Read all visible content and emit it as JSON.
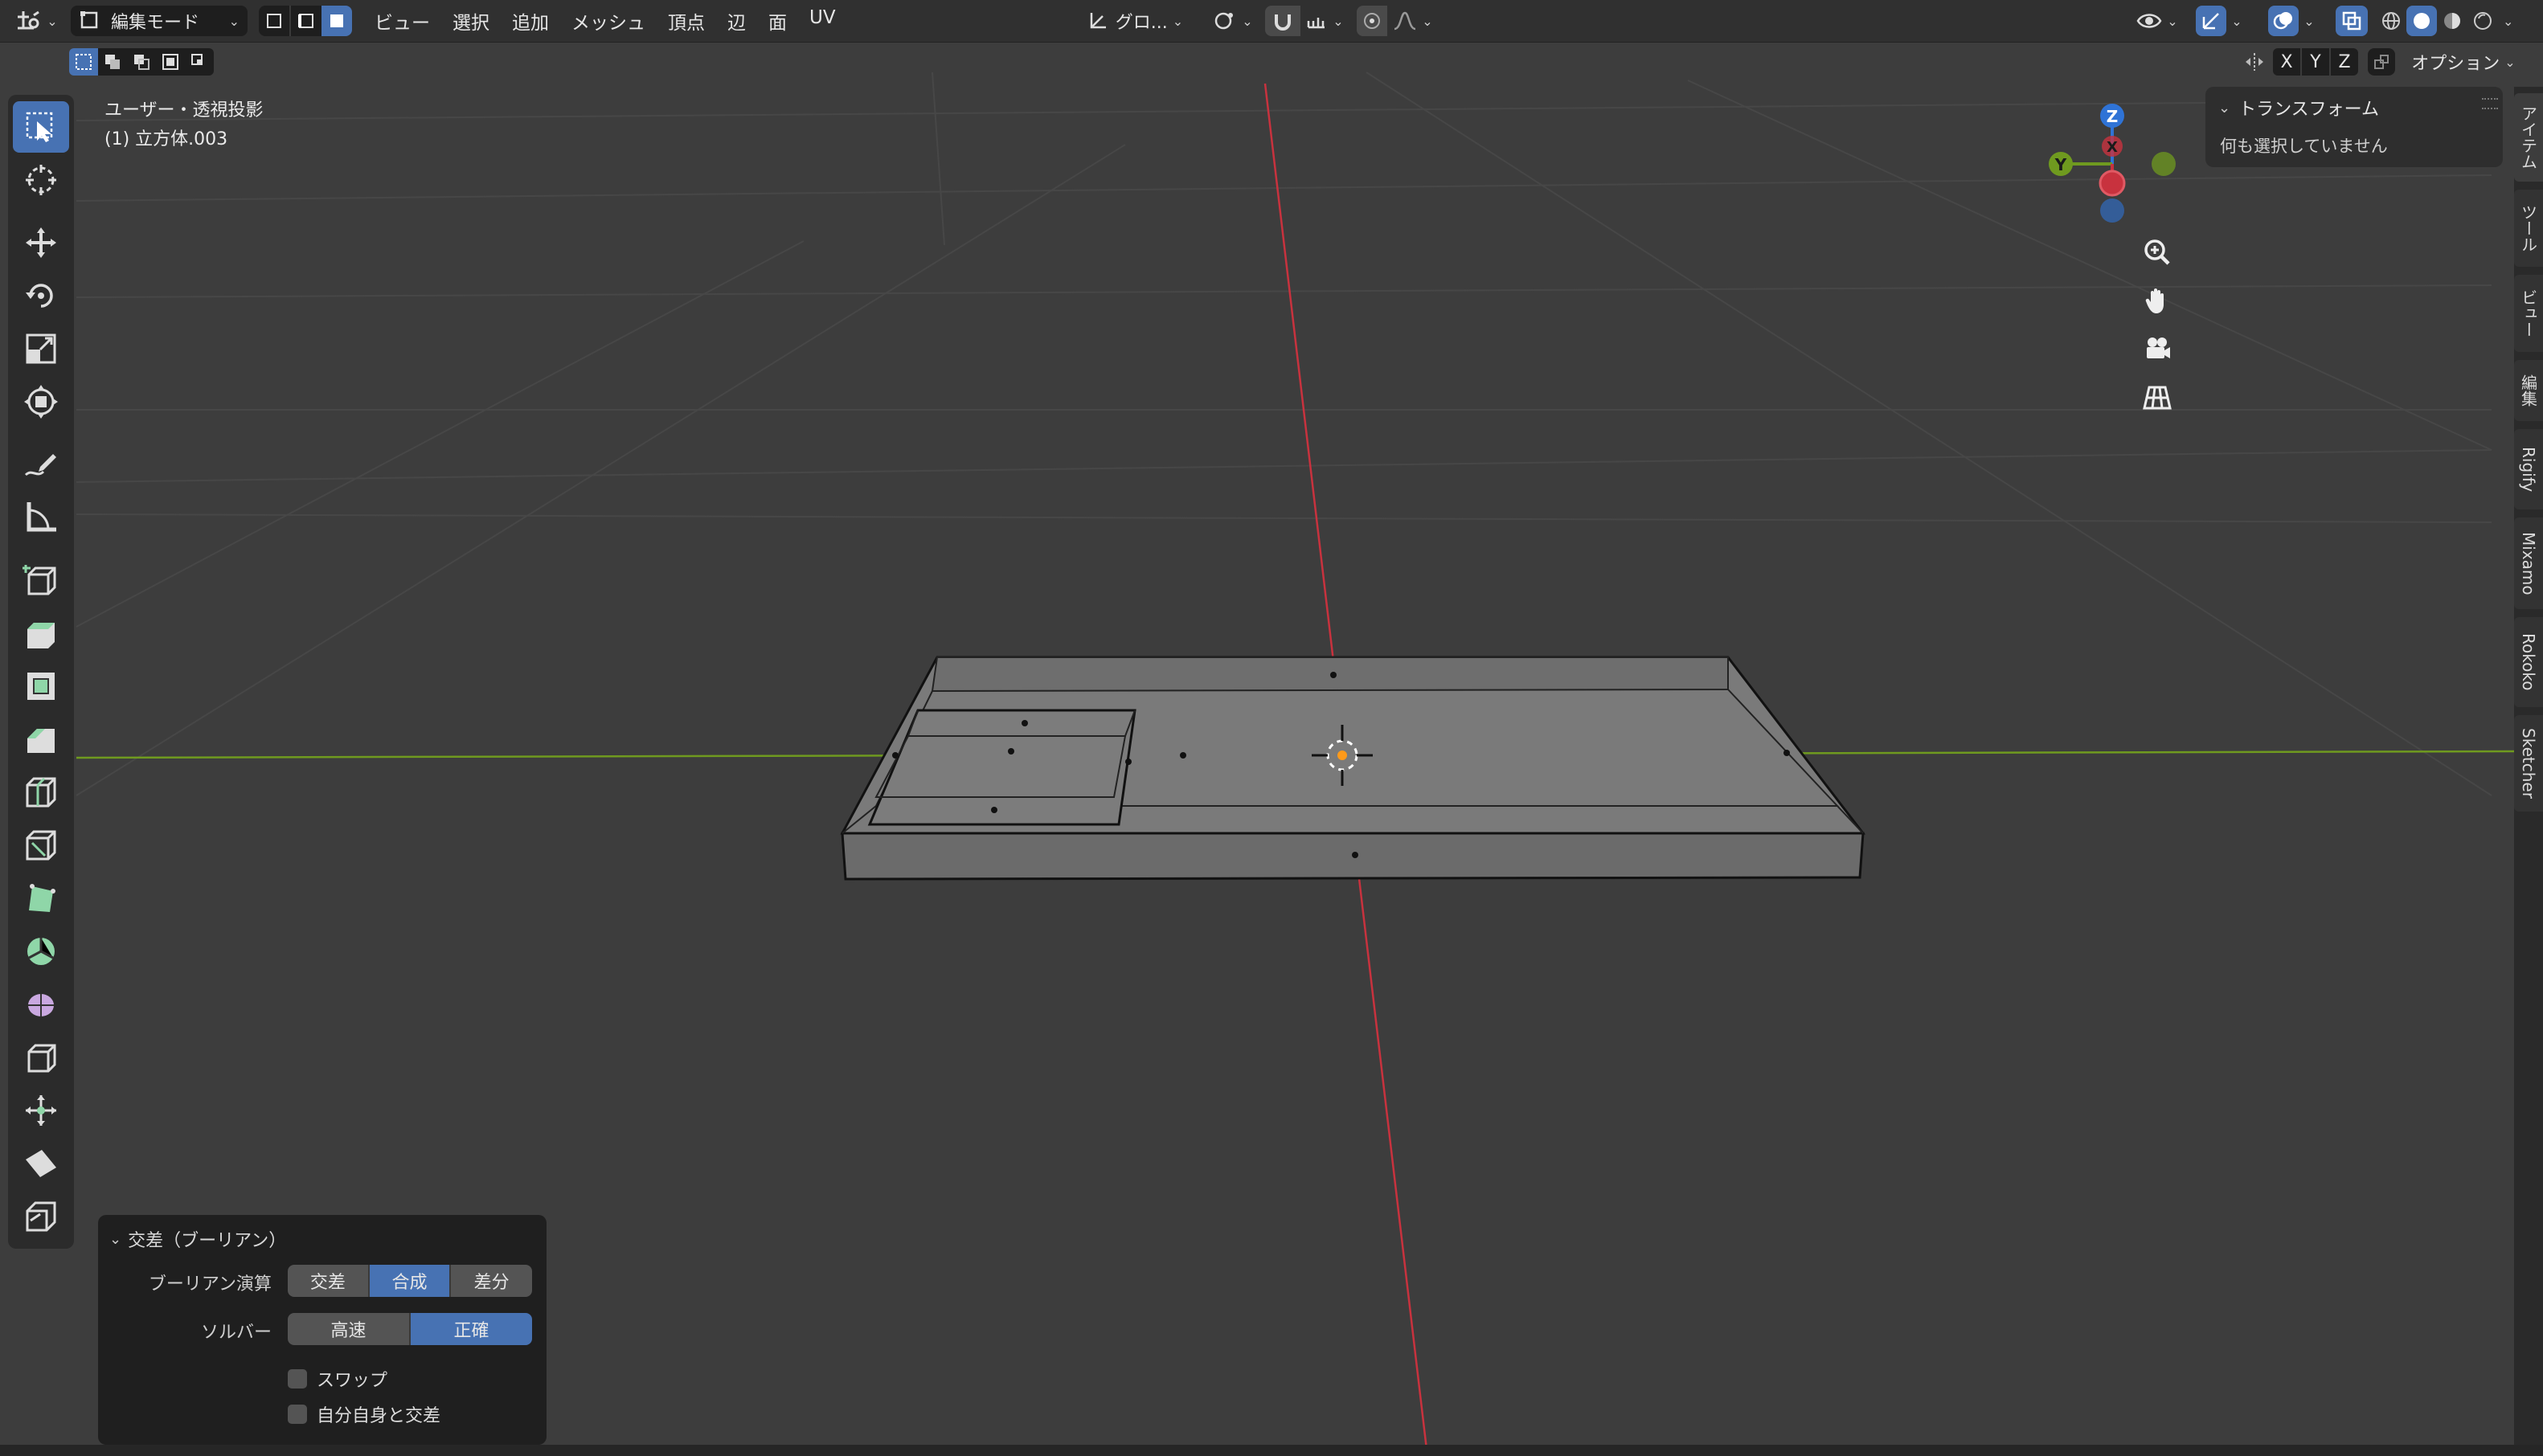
{
  "header": {
    "mode_label": "編集モード",
    "menus": [
      "ビュー",
      "選択",
      "追加",
      "メッシュ",
      "頂点",
      "辺",
      "面",
      "UV"
    ],
    "transform_orientation": "グロ...",
    "options_label": "オプション",
    "axes": [
      "X",
      "Y",
      "Z"
    ]
  },
  "viewport": {
    "view_name": "ユーザー・透視投影",
    "object_name": "(1) 立方体.003",
    "gizmo": {
      "z": "Z",
      "y": "Y",
      "x": "X"
    }
  },
  "npanel": {
    "section_title": "トランスフォーム",
    "empty_message": "何も選択していません"
  },
  "side_tabs": [
    "アイテム",
    "ツール",
    "ビュー",
    "編集",
    "Rigify",
    "Mixamo",
    "Rokoko",
    "Sketcher"
  ],
  "operator_panel": {
    "title": "交差（ブーリアン）",
    "boolean_label": "ブーリアン演算",
    "boolean_options": [
      "交差",
      "合成",
      "差分"
    ],
    "boolean_selected": "合成",
    "solver_label": "ソルバー",
    "solver_options": [
      "高速",
      "正確"
    ],
    "solver_selected": "正確",
    "swap_label": "スワップ",
    "self_intersect_label": "自分自身と交差"
  },
  "colors": {
    "accent": "#4772b3",
    "axis_x": "#c8323e",
    "axis_y": "#6f9a1f",
    "axis_z": "#2f73d6"
  }
}
